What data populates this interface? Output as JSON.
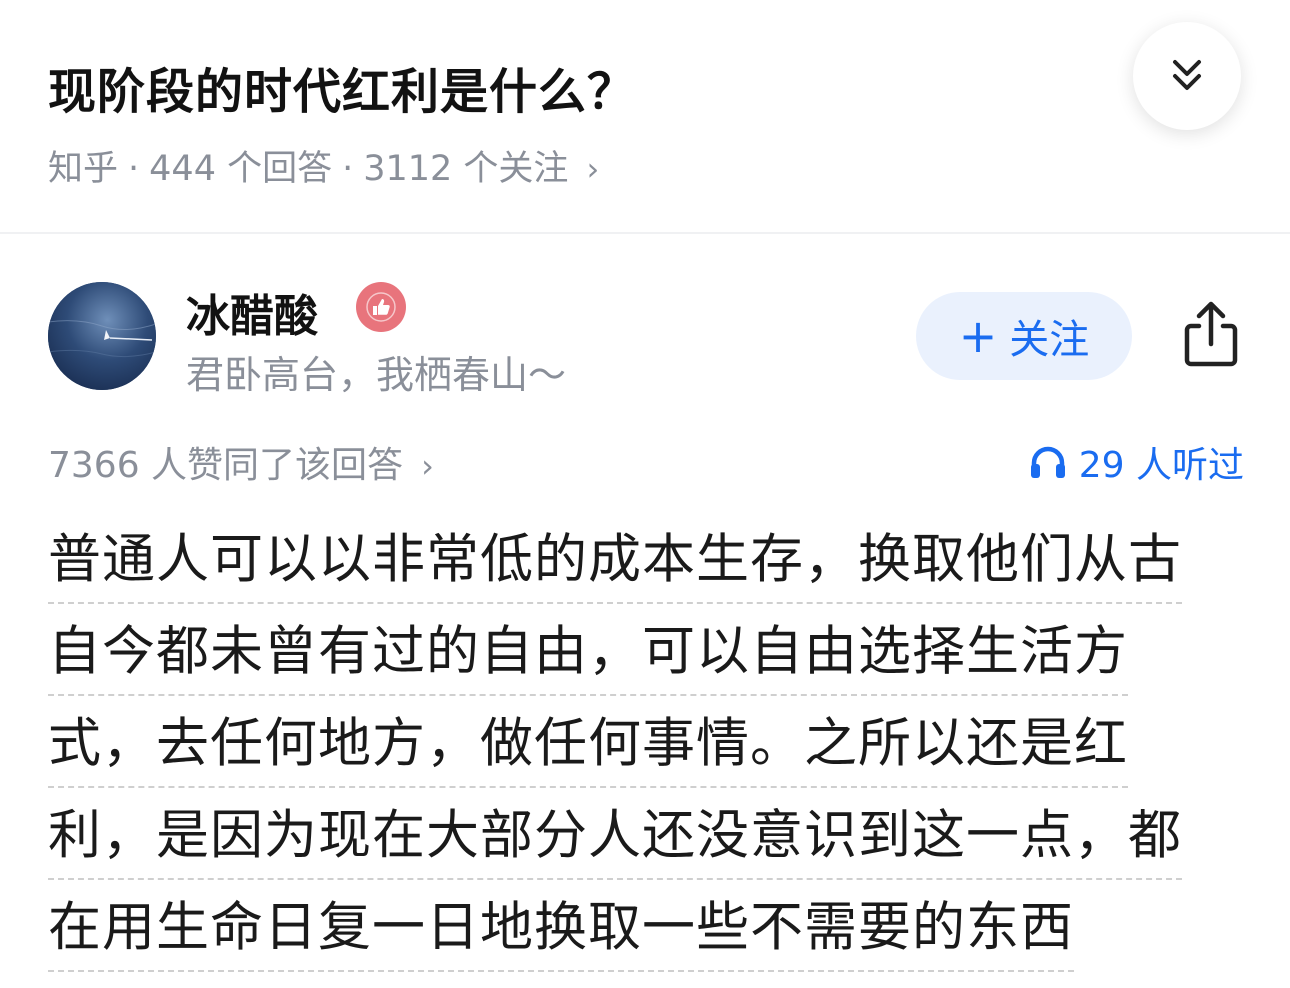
{
  "question": {
    "title": "现阶段的时代红利是什么？",
    "source": "知乎",
    "separator": "·",
    "answers": "444 个回答",
    "followers": "3112 个关注",
    "chevron": "›"
  },
  "collapse_icon": "double-chevron-down-icon",
  "author": {
    "name": "冰醋酸",
    "badge_icon": "thumbs-up-badge-icon",
    "bio": "君卧高台，我栖春山～",
    "follow_label": "关注",
    "follow_prefix": "+",
    "share_icon": "share-icon"
  },
  "stats": {
    "votes": "7366 人赞同了该回答",
    "votes_chevron": "›",
    "listens": "29 人听过",
    "listen_icon": "headphones-icon"
  },
  "answer": {
    "lines": [
      "普通人可以以非常低的成本生存，换取他们从古",
      "自今都未曾有过的自由，可以自由选择生活方",
      "式，去任何地方，做任何事情。之所以还是红",
      "利，是因为现在大部分人还没意识到这一点，都",
      "在用生命日复一日地换取一些不需要的东西"
    ]
  },
  "colors": {
    "accent": "#1a6cf0",
    "muted": "#8a8f99",
    "follow_bg": "#eaf1fd",
    "badge": "#e8747c"
  }
}
